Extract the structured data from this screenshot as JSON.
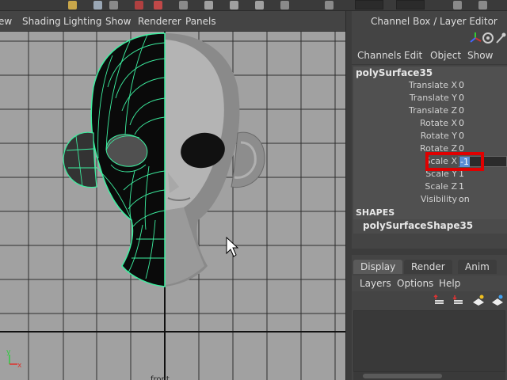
{
  "viewport": {
    "menu": [
      "ew",
      "Shading",
      "Lighting",
      "Show",
      "Renderer",
      "Panels"
    ],
    "camera_label": "front",
    "axis_labels": {
      "x": "x",
      "y": "y"
    }
  },
  "channel_box": {
    "title": "Channel Box / Layer Editor",
    "menu": [
      "Channels",
      "Edit",
      "Object",
      "Show"
    ],
    "object_name": "polySurface35",
    "attributes": [
      {
        "label": "Translate X",
        "value": "0"
      },
      {
        "label": "Translate Y",
        "value": "0"
      },
      {
        "label": "Translate Z",
        "value": "0"
      },
      {
        "label": "Rotate X",
        "value": "0"
      },
      {
        "label": "Rotate Y",
        "value": "0"
      },
      {
        "label": "Rotate Z",
        "value": "0"
      },
      {
        "label": "Scale X",
        "value": "-1"
      },
      {
        "label": "Scale Y",
        "value": "1"
      },
      {
        "label": "Scale Z",
        "value": "1"
      },
      {
        "label": "Visibility",
        "value": "on"
      }
    ],
    "shapes_header": "SHAPES",
    "shape_name": "polySurfaceShape35",
    "highlight_color": "#e00000"
  },
  "layer_editor": {
    "tabs": [
      "Display",
      "Render",
      "Anim"
    ],
    "active_tab": "Display",
    "menu": [
      "Layers",
      "Options",
      "Help"
    ]
  }
}
